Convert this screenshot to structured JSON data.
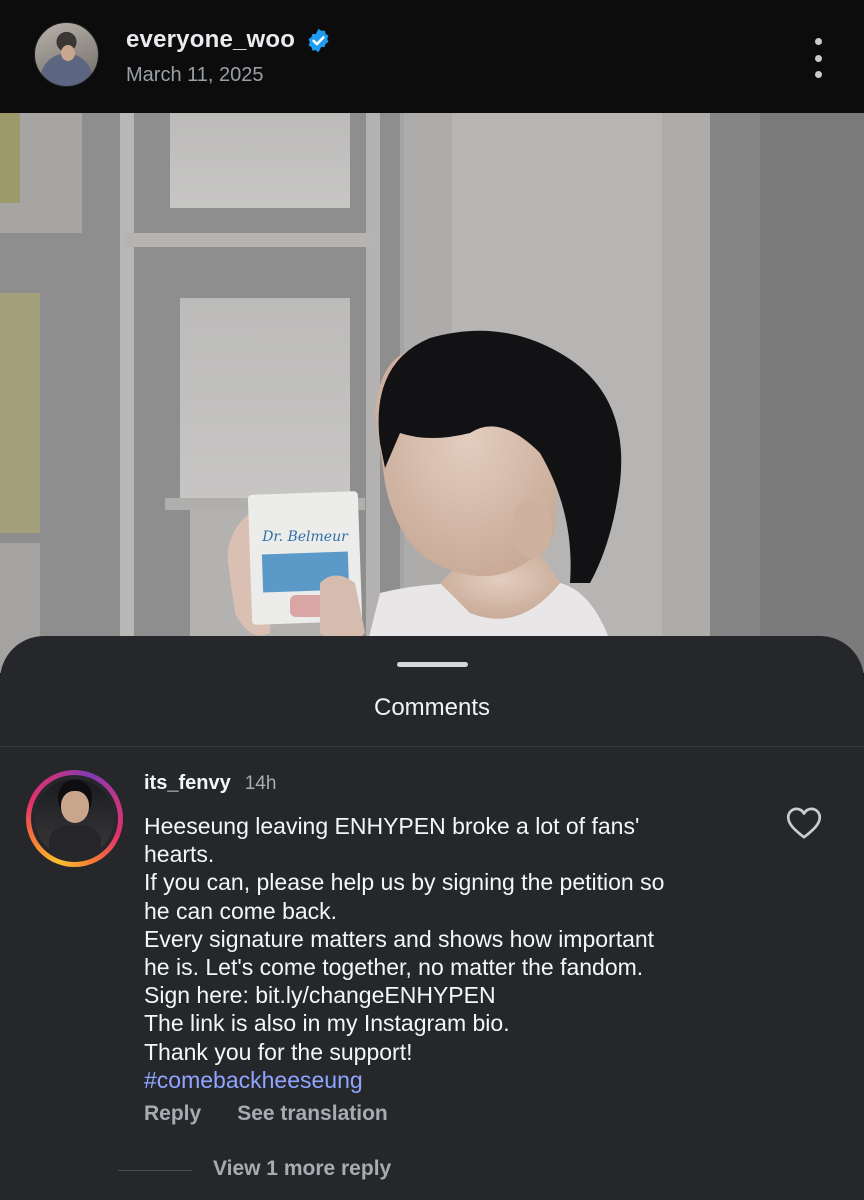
{
  "post": {
    "username": "everyone_woo",
    "verified": true,
    "date": "March 11, 2025"
  },
  "photo": {
    "product_logo": "Dr. Belmeur"
  },
  "comments_sheet": {
    "title": "Comments"
  },
  "comment": {
    "username": "its_fenvy",
    "time": "14h",
    "lines": [
      "Heeseung leaving ENHYPEN broke a lot of fans'",
      "hearts.",
      "If you can, please help us by signing the petition so",
      "he can come back.",
      "Every signature matters and shows how important",
      "he is. Let's come together, no matter the fandom.",
      "Sign here: bit.ly/changeENHYPEN",
      "The link is also in my Instagram bio.",
      "Thank you for the support!"
    ],
    "hashtag": "#comebackheeseung",
    "reply_label": "Reply",
    "translation_label": "See translation",
    "view_replies_label": "View 1 more reply"
  },
  "colors": {
    "verified_blue": "#1d9bf0",
    "hashtag": "#8fa5ff",
    "sheet_bg": "#25272b"
  },
  "icons": [
    "verified-badge-icon",
    "more-options-icon",
    "heart-icon"
  ]
}
